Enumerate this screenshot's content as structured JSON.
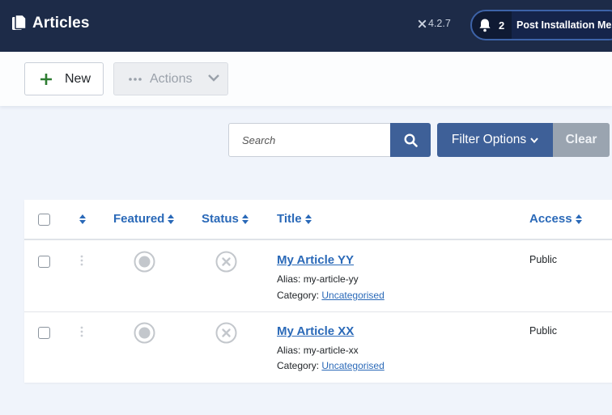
{
  "header": {
    "title": "Articles",
    "version": "4.2.7",
    "notifications_count": "2",
    "notifications_label": "Post Installation Messages"
  },
  "toolbar": {
    "new_label": "New",
    "actions_label": "Actions"
  },
  "filters": {
    "search_placeholder": "Search",
    "filter_options_label": "Filter Options",
    "clear_label": "Clear"
  },
  "table": {
    "columns": {
      "featured": "Featured",
      "status": "Status",
      "title": "Title",
      "access": "Access"
    },
    "rows": [
      {
        "title": "My Article YY",
        "alias_label": "Alias:",
        "alias": "my-article-yy",
        "category_label": "Category:",
        "category": "Uncategorised",
        "access": "Public"
      },
      {
        "title": "My Article XX",
        "alias_label": "Alias:",
        "alias": "my-article-xx",
        "category_label": "Category:",
        "category": "Uncategorised",
        "access": "Public"
      }
    ]
  },
  "colors": {
    "header_bg": "#1d2b48",
    "primary": "#3e6098",
    "link": "#2a69b8",
    "new_plus": "#2e7d32",
    "clear_bg": "#9aa4b0"
  },
  "icons": {
    "header": "documents-icon",
    "version": "joomla-icon",
    "notification": "bell-icon",
    "new": "plus-icon",
    "actions": "ellipsis-icon",
    "search": "search-icon",
    "featured": "unfeatured-circle-icon",
    "status": "unpublished-x-icon"
  }
}
